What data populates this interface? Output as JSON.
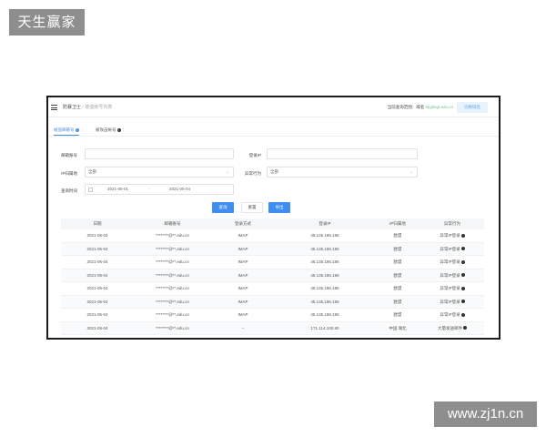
{
  "watermarks": {
    "top": "天生赢家",
    "bottom": "www.zj1n.cn"
  },
  "topbar": {
    "breadcrumb_root": "防暴卫士",
    "breadcrumb_sep": "/",
    "breadcrumb_current": "被盗账号列表",
    "account_label": "当前查询范围：域名",
    "account_value": "tingtingt.edu.cn",
    "switch_button": "切换域名"
  },
  "tabs": [
    {
      "label": "被盗邮箱号"
    },
    {
      "label": "被攻击帐号"
    }
  ],
  "filters": {
    "email": {
      "label": "邮箱账号",
      "value": ""
    },
    "login_ip": {
      "label": "登录IP",
      "value": ""
    },
    "ip_region": {
      "label": "IP归属地",
      "value": "全部"
    },
    "anomaly": {
      "label": "异常行为",
      "value": "全部"
    },
    "date_range": {
      "label": "查询时间",
      "start": "2021-05-01",
      "sep": "-",
      "end": "2021-05-04"
    }
  },
  "buttons": {
    "query": "查询",
    "reset": "重置",
    "export": "导出"
  },
  "table": {
    "headers": [
      "日期",
      "邮箱账号",
      "登录方式",
      "登录IP",
      "IP归属地",
      "异常行为"
    ],
    "rows": [
      [
        "2021-05-04",
        "********@**.edu.cn",
        "IMAP",
        "45.135.186.186",
        "欧盟",
        "异常IP登录"
      ],
      [
        "2021-05-04",
        "********@**.edu.cn",
        "IMAP",
        "45.135.186.186",
        "欧盟",
        "异常IP登录"
      ],
      [
        "2021-05-04",
        "********@**.edu.cn",
        "IMAP",
        "45.135.186.186",
        "欧盟",
        "异常IP登录"
      ],
      [
        "2021-05-04",
        "********@**.edu.cn",
        "IMAP",
        "45.135.186.186",
        "欧盟",
        "异常IP登录"
      ],
      [
        "2021-05-04",
        "********@**.edu.cn",
        "IMAP",
        "45.135.186.186",
        "欧盟",
        "异常IP登录"
      ],
      [
        "2021-05-04",
        "********@**.edu.cn",
        "IMAP",
        "45.135.186.186",
        "欧盟",
        "异常IP登录"
      ],
      [
        "2021-05-04",
        "********@**.edu.cn",
        "IMAP",
        "45.135.186.186",
        "欧盟",
        "异常IP登录"
      ],
      [
        "2021-05-04",
        "********@**.edu.cn",
        "--",
        "171.114.100.80",
        "中国 湖北",
        "大量发送邮件"
      ]
    ]
  }
}
